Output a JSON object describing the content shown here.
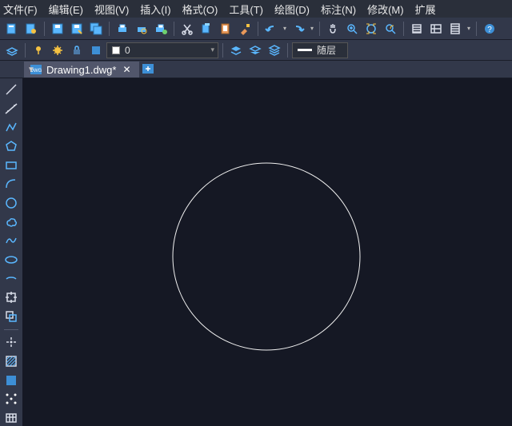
{
  "menu": {
    "file": "文件(F)",
    "edit": "编辑(E)",
    "view": "视图(V)",
    "insert": "插入(I)",
    "format": "格式(O)",
    "tools": "工具(T)",
    "draw": "绘图(D)",
    "annotate": "标注(N)",
    "modify": "修改(M)",
    "extend": "扩展"
  },
  "layer": {
    "name": "0"
  },
  "linetype": {
    "label": "随层"
  },
  "tab": {
    "filename": "Drawing1.dwg*"
  }
}
